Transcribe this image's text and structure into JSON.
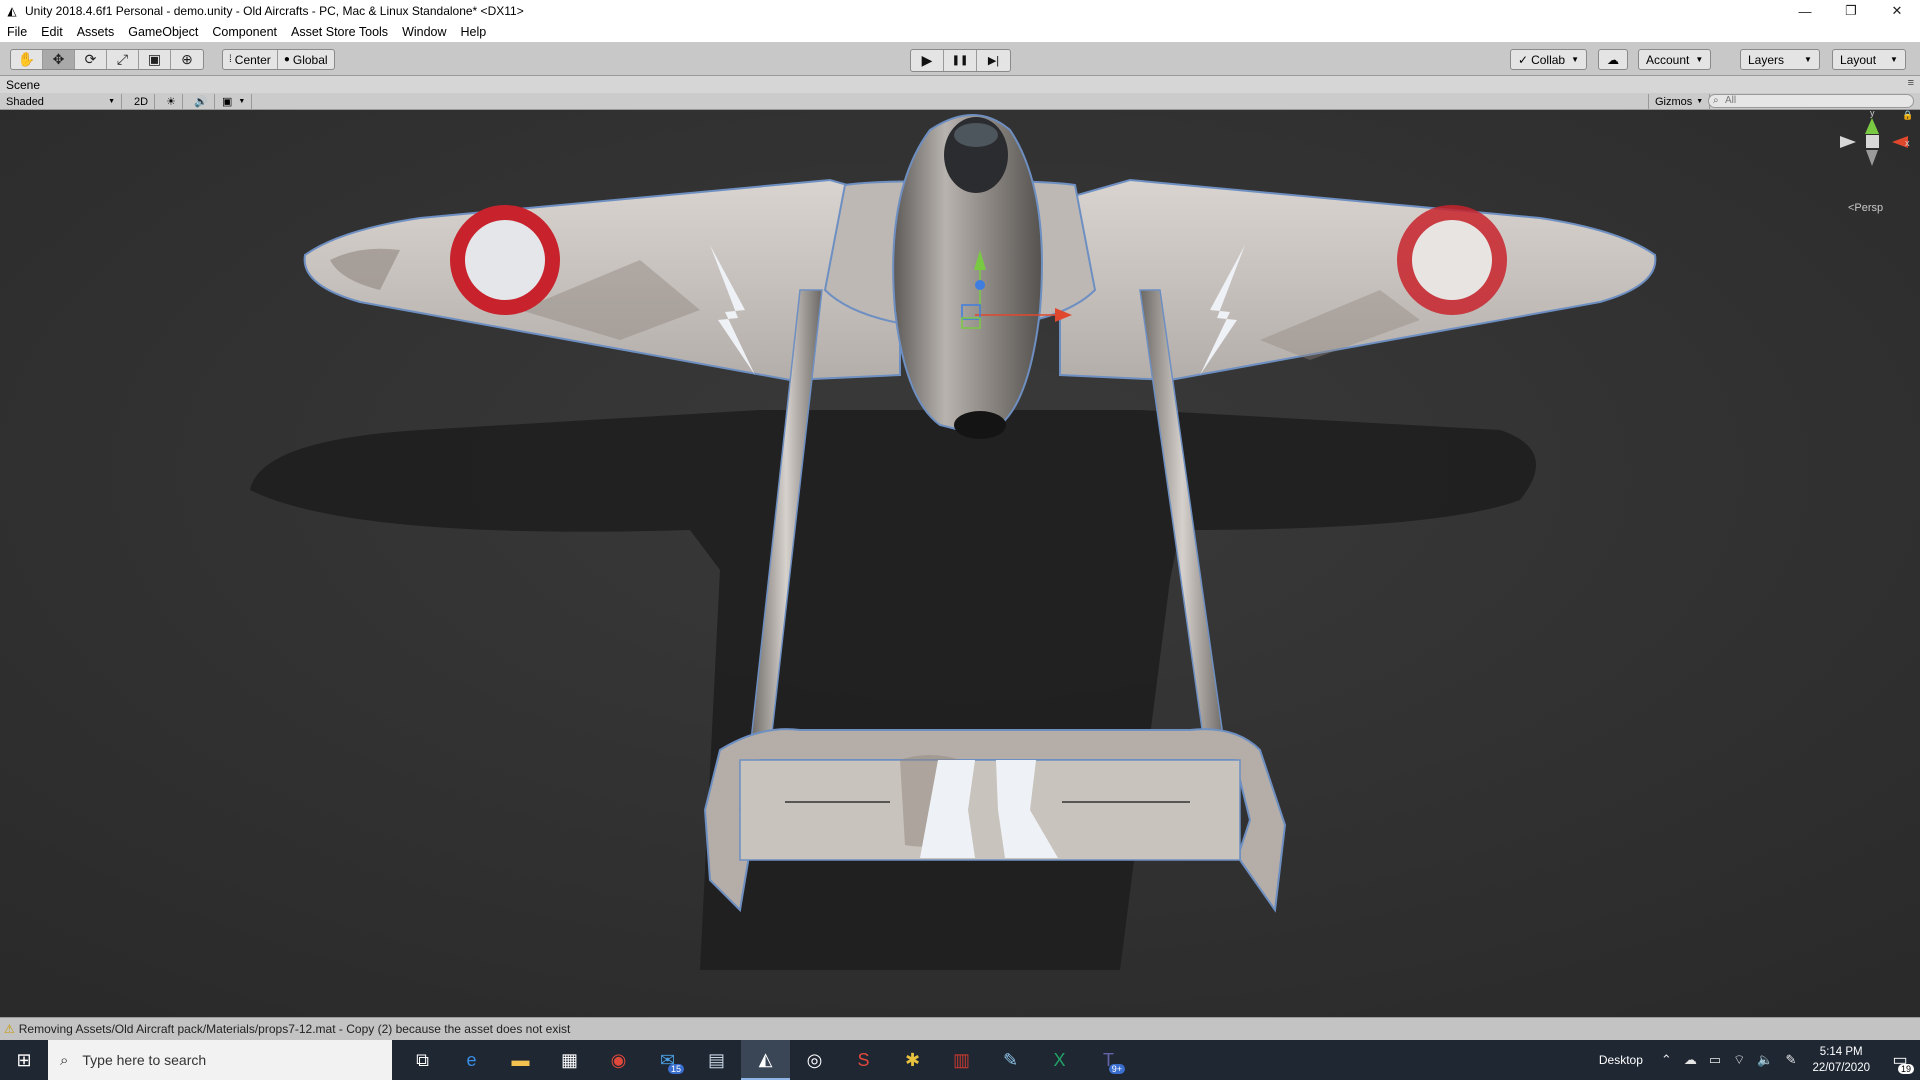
{
  "window": {
    "title": "Unity 2018.4.6f1 Personal - demo.unity - Old Aircrafts - PC, Mac & Linux Standalone* <DX11>",
    "controls": {
      "minimize": "—",
      "restore": "❐",
      "close": "✕"
    }
  },
  "menu": [
    "File",
    "Edit",
    "Assets",
    "GameObject",
    "Component",
    "Asset Store Tools",
    "Window",
    "Help"
  ],
  "toolbar": {
    "tools": [
      {
        "name": "hand-tool",
        "glyph": "✋"
      },
      {
        "name": "move-tool",
        "glyph": "✥"
      },
      {
        "name": "rotate-tool",
        "glyph": "⟳"
      },
      {
        "name": "scale-tool",
        "glyph": "⤢"
      },
      {
        "name": "rect-tool",
        "glyph": "▣"
      },
      {
        "name": "transform-tool",
        "glyph": "⊕"
      }
    ],
    "active_tool": "move-tool",
    "pivot": "Center",
    "space": "Global",
    "play": "▶",
    "pause": "❚❚",
    "step": "▶|",
    "collab": "Collab",
    "cloud": "☁",
    "account": "Account",
    "layers": "Layers",
    "layout": "Layout"
  },
  "scene": {
    "tab": "Scene",
    "shading": "Shaded",
    "mode_2d": "2D",
    "light": "☀",
    "audio": "🔊",
    "effects": "▣",
    "gizmos": "Gizmos",
    "search_placeholder": "All",
    "persp_label": "<Persp",
    "axes": {
      "y": "y",
      "x": "x"
    }
  },
  "status": {
    "message": "Removing Assets/Old Aircraft pack/Materials/props7-12.mat - Copy (2) because the asset does not exist"
  },
  "taskbar": {
    "search_placeholder": "Type here to search",
    "icons": [
      {
        "name": "task-view-icon",
        "glyph": "⧉"
      },
      {
        "name": "edge-icon",
        "glyph": "e",
        "color": "#3a8ee6"
      },
      {
        "name": "file-explorer-icon",
        "glyph": "▬",
        "color": "#f2c14e"
      },
      {
        "name": "store-icon",
        "glyph": "▦",
        "color": "#ffffff"
      },
      {
        "name": "chrome-icon",
        "glyph": "◉",
        "color": "#e0483b"
      },
      {
        "name": "mail-icon",
        "glyph": "✉",
        "color": "#4aa3e6",
        "badge": "15"
      },
      {
        "name": "printer-app-icon",
        "glyph": "▤",
        "color": "#c9d6e6"
      },
      {
        "name": "unity-icon",
        "glyph": "◭",
        "color": "#ffffff"
      },
      {
        "name": "unity-hub-icon",
        "glyph": "◎",
        "color": "#ffffff"
      },
      {
        "name": "sketchup-icon",
        "glyph": "S",
        "color": "#e0483b"
      },
      {
        "name": "slack-icon",
        "glyph": "✱",
        "color": "#e8c23d"
      },
      {
        "name": "winrar-icon",
        "glyph": "▥",
        "color": "#c63a2e"
      },
      {
        "name": "paint-icon",
        "glyph": "✎",
        "color": "#8fc6e8"
      },
      {
        "name": "excel-icon",
        "glyph": "X",
        "color": "#21a366"
      },
      {
        "name": "teams-icon",
        "glyph": "T",
        "color": "#6264a7",
        "badge": "9+"
      }
    ],
    "desktop": "Desktop",
    "time": "5:14 PM",
    "date": "22/07/2020",
    "notifications": "19"
  },
  "colors": {
    "viewport_bg": "#333333",
    "aircraft_body": "#cfcac6",
    "roundel_red": "#c8232c",
    "gizmo_x": "#e0482e",
    "gizmo_y": "#7ac943",
    "gizmo_z": "#3f7de0"
  }
}
